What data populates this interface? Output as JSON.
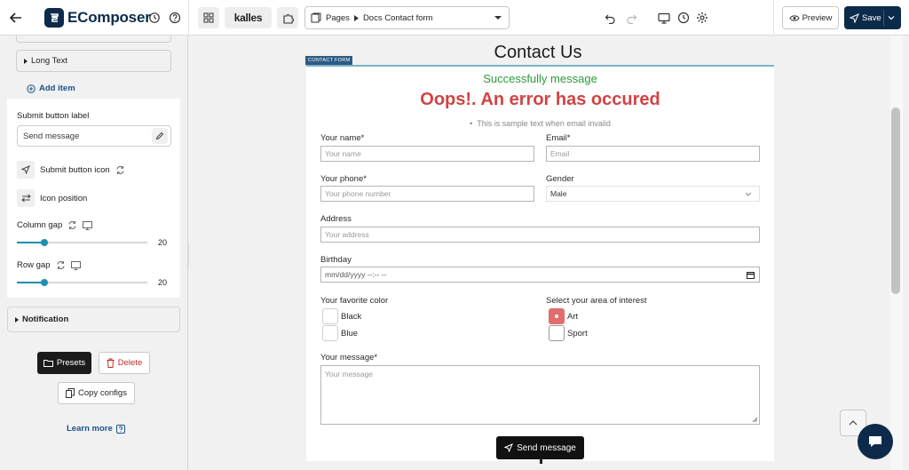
{
  "topbar": {
    "brand": "EComposer",
    "store": "kalles",
    "page_selector": {
      "section": "Pages",
      "page": "Docs Contact form"
    },
    "preview_label": "Preview",
    "save_label": "Save"
  },
  "sidebar": {
    "long_text_label": "Long Text",
    "add_item_label": "Add item",
    "submit_button_label_title": "Submit button label",
    "submit_button_label_value": "Send message",
    "submit_button_icon_label": "Submit button icon",
    "icon_position_label": "Icon position",
    "column_gap": {
      "label": "Column gap",
      "value": "20",
      "fraction": 0.21
    },
    "row_gap": {
      "label": "Row gap",
      "value": "20",
      "fraction": 0.21
    },
    "notification_label": "Notification",
    "presets_label": "Presets",
    "delete_label": "Delete",
    "copy_configs_label": "Copy configs",
    "learn_more_label": "Learn more"
  },
  "canvas": {
    "page_title": "Contact Us",
    "form_badge": "CONTACT FORM",
    "success_message": "Successfully message",
    "error_message": "Oops!. An error has occured",
    "error_note": "This is sample text when email invalid",
    "fields": {
      "name": {
        "label": "Your name*",
        "placeholder": "Your name"
      },
      "email": {
        "label": "Email*",
        "placeholder": "Email"
      },
      "phone": {
        "label": "Your phone*",
        "placeholder": "Your phone number"
      },
      "gender": {
        "label": "Gender",
        "value": "Male"
      },
      "address": {
        "label": "Address",
        "placeholder": "Your address"
      },
      "birthday": {
        "label": "Birthday",
        "value": "mm/dd/yyyy --:-- --"
      },
      "favorite_color": {
        "label": "Your favorite color",
        "options": [
          "Black",
          "Blue"
        ]
      },
      "interest": {
        "label": "Select your area of interest",
        "options": [
          "Art",
          "Sport"
        ],
        "checked": "Art"
      },
      "message": {
        "label": "Your message*",
        "placeholder": "Your message"
      }
    },
    "send_label": "Send message"
  },
  "colors": {
    "brand_navy": "#0c2b4b",
    "success_green": "#2e9b3a",
    "error_red": "#d14343",
    "checkbox_checked": "#e26d6d",
    "slider_accent": "#1f8fb0"
  }
}
